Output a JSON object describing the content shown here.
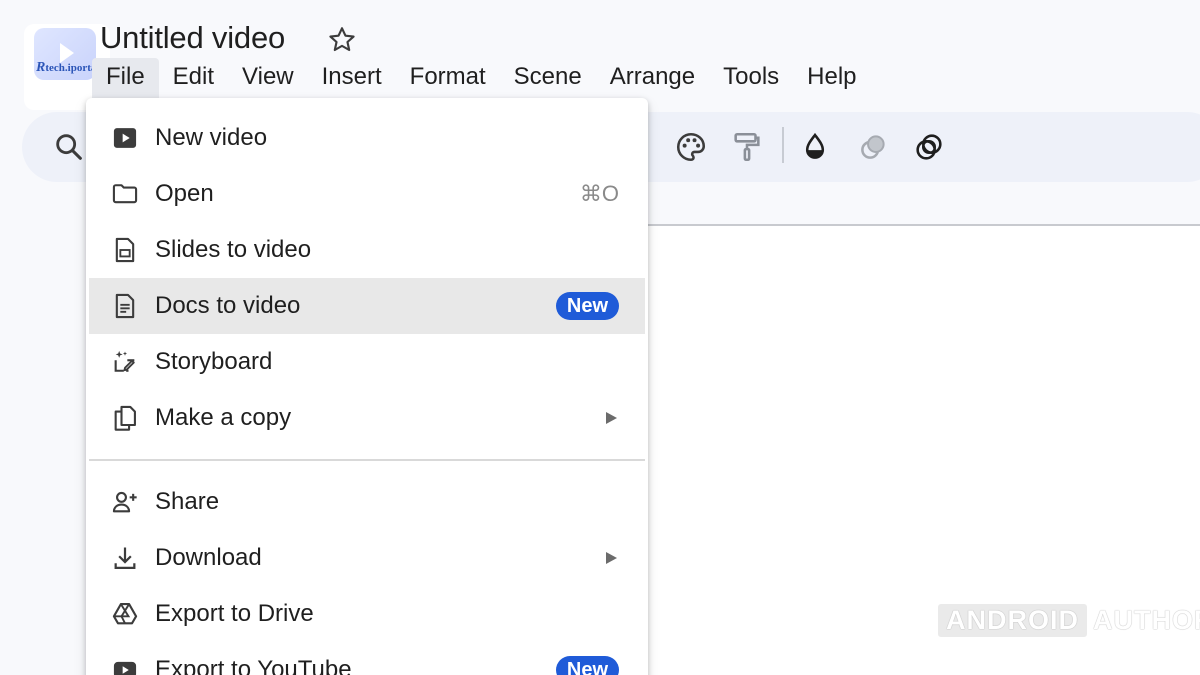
{
  "header": {
    "title": "Untitled video",
    "star_icon": "star-outline-icon",
    "watermark": {
      "prefix": "R",
      "text": "tech.iportal"
    }
  },
  "menubar": {
    "items": [
      "File",
      "Edit",
      "View",
      "Insert",
      "Format",
      "Scene",
      "Arrange",
      "Tools",
      "Help"
    ],
    "active": "File"
  },
  "toolbar": {
    "icons": [
      "search-icon",
      "palette-icon",
      "paint-roller-icon",
      "fill-drop-icon",
      "opacity-icon",
      "blend-rings-icon"
    ]
  },
  "file_menu": {
    "items": [
      {
        "label": "New video",
        "icon": "video-play-icon"
      },
      {
        "label": "Open",
        "icon": "folder-icon",
        "shortcut": "⌘O"
      },
      {
        "label": "Slides to video",
        "icon": "slides-icon"
      },
      {
        "label": "Docs to video",
        "icon": "docs-icon",
        "badge": "New",
        "highlighted": true
      },
      {
        "label": "Storyboard",
        "icon": "storyboard-sparkle-icon"
      },
      {
        "label": "Make a copy",
        "icon": "copy-icon",
        "submenu": true
      },
      {
        "label": "Share",
        "icon": "person-add-icon"
      },
      {
        "label": "Download",
        "icon": "download-icon",
        "submenu": true
      },
      {
        "label": "Export to Drive",
        "icon": "drive-icon"
      },
      {
        "label": "Export to YouTube",
        "icon": "youtube-icon",
        "badge": "New"
      }
    ]
  },
  "watermark_br": {
    "box": "ANDROID",
    "text": "AUTHORITY"
  },
  "colors": {
    "badge": "#1f5bd8",
    "highlight": "#e8e8e8",
    "toolbar": "#eef1f9",
    "background": "#f8f9fc"
  }
}
